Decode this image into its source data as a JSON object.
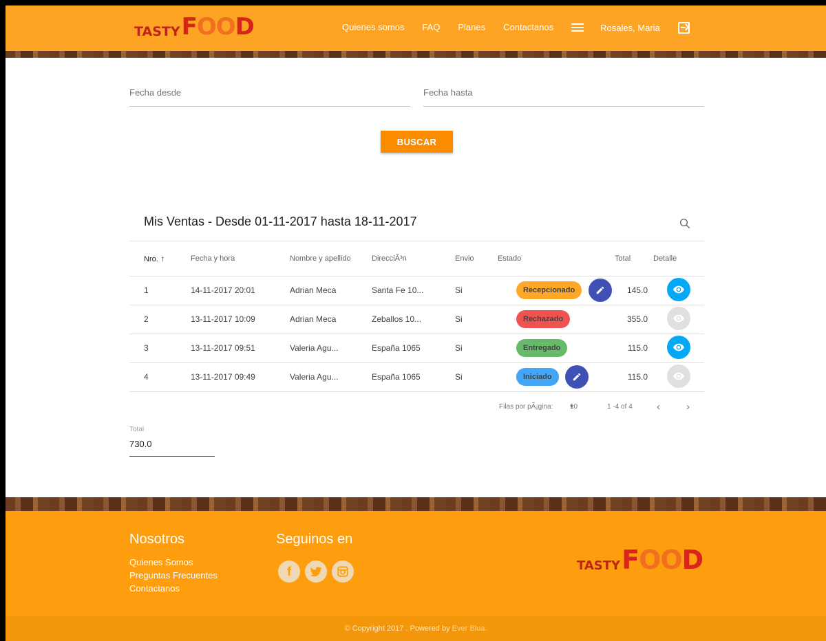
{
  "header": {
    "logo_tasty": "TASTY",
    "logo_food_f": "F",
    "logo_food_oo": "OO",
    "logo_food_d": "D",
    "nav": [
      "Quienes somos",
      "FAQ",
      "Planes",
      "Contactanos"
    ],
    "user": "Rosales, Maria"
  },
  "filters": {
    "desde_label": "Fecha desde",
    "hasta_label": "Fecha hasta",
    "buscar_label": "BUSCAR"
  },
  "table": {
    "title": "Mis Ventas - Desde 01-11-2017 hasta 18-11-2017",
    "columns": [
      "Nro.",
      "Fecha y hora",
      "Nombre y apellido",
      "DirecciÃ³n",
      "Envio",
      "Estado",
      "Total",
      "Detalle"
    ],
    "rows": [
      {
        "nro": "1",
        "fecha": "14-11-2017 20:01",
        "nombre": "Adrian Meca",
        "direccion": "Santa Fe 10...",
        "envio": "Si",
        "estado": "Recepcionado",
        "total": "145.0"
      },
      {
        "nro": "2",
        "fecha": "13-11-2017 10:09",
        "nombre": "Adrian Meca",
        "direccion": "Zeballos 10...",
        "envio": "Si",
        "estado": "Rechazado",
        "total": "355.0"
      },
      {
        "nro": "3",
        "fecha": "13-11-2017 09:51",
        "nombre": "Valeria Agu...",
        "direccion": "España 1065",
        "envio": "Si",
        "estado": "Entregado",
        "total": "115.0"
      },
      {
        "nro": "4",
        "fecha": "13-11-2017 09:49",
        "nombre": "Valeria Agu...",
        "direccion": "España 1065",
        "envio": "Si",
        "estado": "Iniciado",
        "total": "115.0"
      }
    ],
    "pager": {
      "rows_label": "Filas por pÃ¡gina:",
      "rows_value": "10",
      "range": "1 -4 of 4"
    }
  },
  "total": {
    "label": "Total",
    "value": "730.0"
  },
  "footer": {
    "nosotros_title": "Nosotros",
    "links": [
      "Quienes Somos",
      "Preguntas Frecuentes",
      "Contactanos"
    ],
    "seguinos_title": "Seguinos en",
    "copyright": "© Copyright 2017 . Powered by ",
    "powered_brand": "Ever Blua."
  },
  "colors": {
    "header_bg": "#fea424",
    "button": "#fb8c00",
    "chip_recepcionado": "#ffa726",
    "chip_rechazado": "#ef5350",
    "chip_entregado": "#66bb6a",
    "chip_iniciado": "#42a5f5",
    "fab_edit": "#3f51b5",
    "fab_view": "#03a9f4"
  }
}
